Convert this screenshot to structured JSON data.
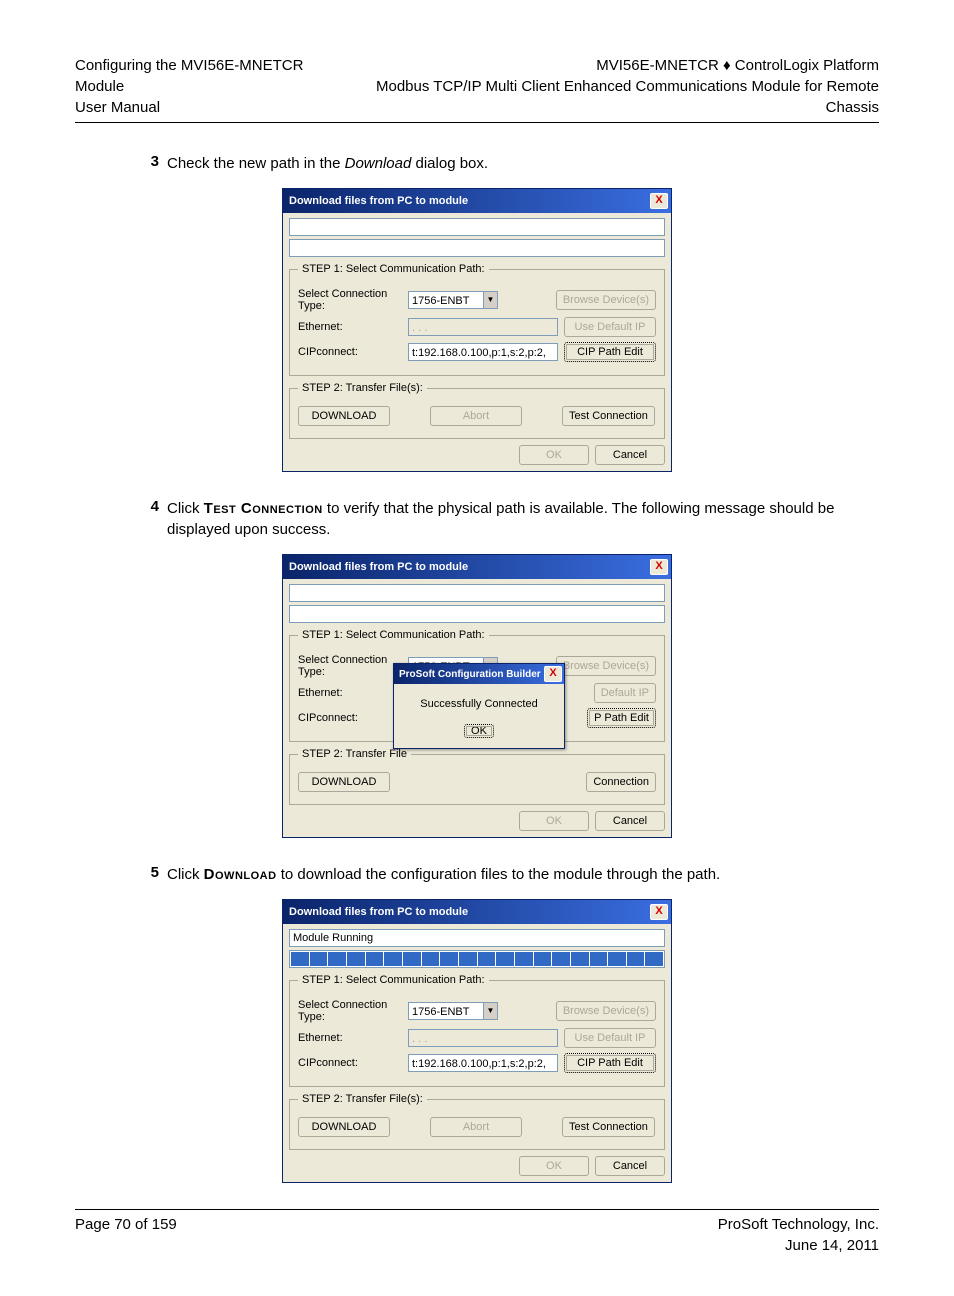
{
  "header": {
    "left1": "Configuring the MVI56E-MNETCR Module",
    "left2": "User Manual",
    "right1": "MVI56E-MNETCR ♦ ControlLogix Platform",
    "right2": "Modbus TCP/IP Multi Client Enhanced Communications Module for Remote Chassis"
  },
  "steps": {
    "s3": {
      "num": "3",
      "pre": "Check the new path in the ",
      "italic": "Download",
      "post": " dialog box."
    },
    "s4": {
      "num": "4",
      "pre": "Click ",
      "sc": "Test Connection",
      "post": " to verify that the physical path is available. The following message should be displayed upon success."
    },
    "s5": {
      "num": "5",
      "pre": "Click ",
      "sc": "Download",
      "post": " to download the configuration files to the module through the path."
    }
  },
  "dialog": {
    "title": "Download files from PC to module",
    "close": "X",
    "status_empty": "",
    "status_running": "Module Running",
    "progress_full": true,
    "step1_legend": "STEP 1: Select Communication Path:",
    "step2_legend": "STEP 2: Transfer File(s):",
    "labels": {
      "conn_type": "Select Connection Type:",
      "ethernet": "Ethernet:",
      "cip": "CIPconnect:"
    },
    "fields": {
      "conn_type_value": "1756-ENBT",
      "ethernet_value": " .   .   .  ",
      "cip_value": "t:192.168.0.100,p:1,s:2,p:2,"
    },
    "buttons": {
      "browse": "Browse Device(s)",
      "use_default_ip": "Use Default IP",
      "default_ip": "Default IP",
      "cip_path_edit": "CIP Path Edit",
      "p_path_edit": "P Path Edit",
      "download": "DOWNLOAD",
      "abort": "Abort",
      "test_connection": "Test Connection",
      "connection": "Connection",
      "ok": "OK",
      "cancel": "Cancel"
    }
  },
  "popup": {
    "title": "ProSoft Configuration Builder",
    "close": "X",
    "message": "Successfully Connected",
    "ok": "OK"
  },
  "footer": {
    "left": "Page 70 of 159",
    "right1": "ProSoft Technology, Inc.",
    "right2": "June 14, 2011"
  }
}
